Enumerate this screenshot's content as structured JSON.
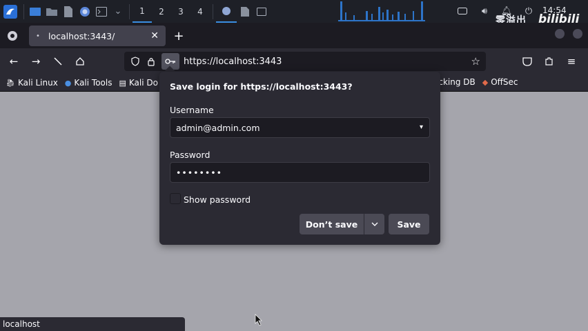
{
  "taskbar": {
    "workspaces": [
      "1",
      "2",
      "3",
      "4"
    ],
    "clock": "14:54",
    "watermark_cn": "零溢出",
    "watermark_logo": "bilibili"
  },
  "tabs": [
    {
      "title": "localhost:3443/"
    }
  ],
  "urlbar": {
    "url": "https://localhost:3443"
  },
  "bookmarks": [
    {
      "label": "Kali Linux",
      "icon": "kali-icon"
    },
    {
      "label": "Kali Tools",
      "icon": "kali-tools-icon"
    },
    {
      "label": "Kali Do",
      "icon": "kali-docs-icon"
    }
  ],
  "bookmarks_right": [
    {
      "label": "acking DB",
      "icon": "exploit-db-icon"
    },
    {
      "label": "OffSec",
      "icon": "offsec-icon"
    }
  ],
  "popup": {
    "title": "Save login for https://localhost:3443?",
    "username_label": "Username",
    "username_value": "admin@admin.com",
    "password_label": "Password",
    "password_value": "••••••••",
    "show_password_label": "Show password",
    "dont_save_label": "Don’t save",
    "save_label": "Save"
  },
  "status_bar": {
    "text": "localhost"
  },
  "colors": {
    "accent": "#3a8fe3",
    "popup_bg": "#2b2a33",
    "field_bg": "#1c1b22",
    "page_bg": "#a5a5ac"
  }
}
